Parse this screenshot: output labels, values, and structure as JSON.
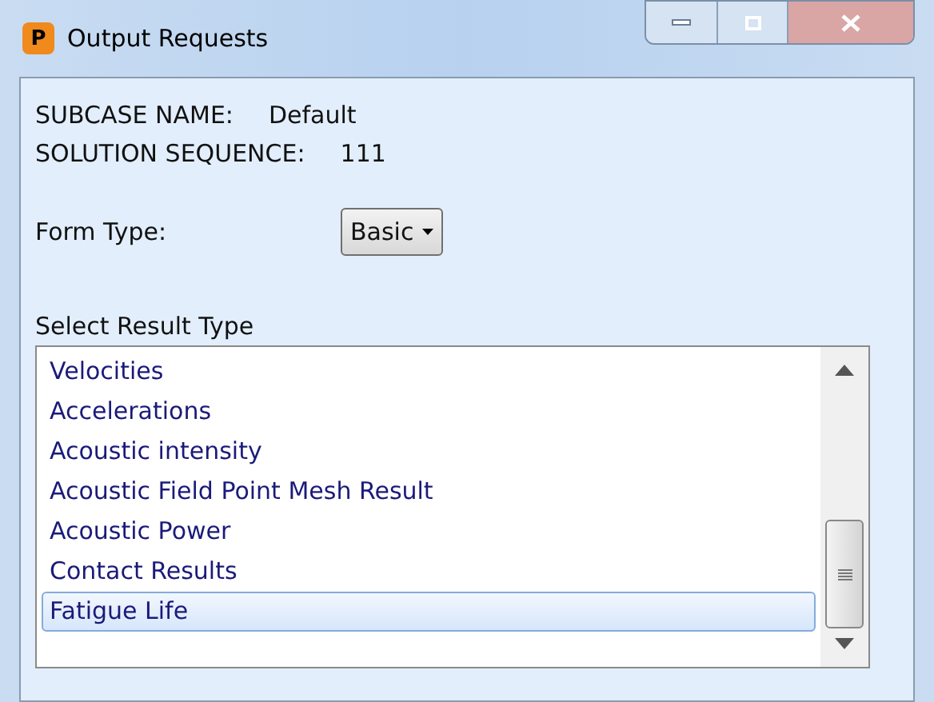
{
  "window": {
    "icon_letter": "P",
    "title": "Output Requests"
  },
  "subcase": {
    "label": "SUBCASE NAME:",
    "value": "Default"
  },
  "solution": {
    "label": "SOLUTION SEQUENCE:",
    "value": "111"
  },
  "form_type": {
    "label": "Form Type:",
    "value": "Basic"
  },
  "result_type": {
    "label": "Select Result Type",
    "items": [
      {
        "label": "Velocities",
        "selected": false
      },
      {
        "label": "Accelerations",
        "selected": false
      },
      {
        "label": "Acoustic intensity",
        "selected": false
      },
      {
        "label": "Acoustic Field Point Mesh Result",
        "selected": false
      },
      {
        "label": "Acoustic Power",
        "selected": false
      },
      {
        "label": "Contact Results",
        "selected": false
      },
      {
        "label": "Fatigue Life",
        "selected": true
      }
    ]
  }
}
